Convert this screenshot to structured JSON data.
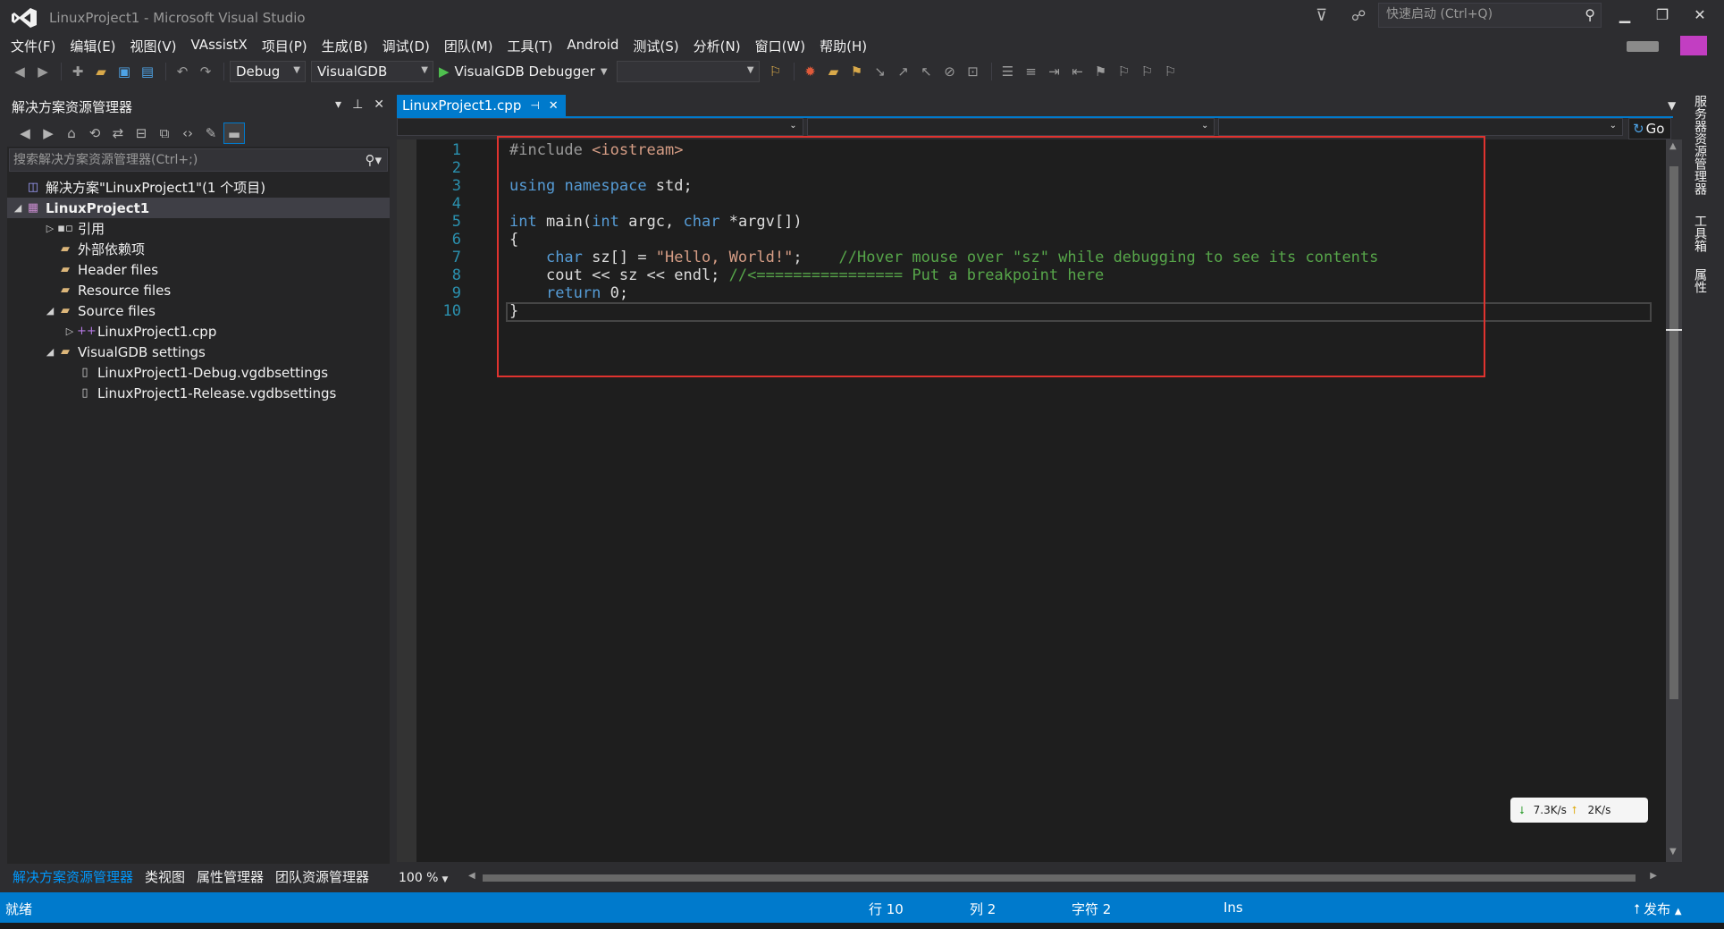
{
  "window": {
    "title": "LinuxProject1 - Microsoft Visual Studio",
    "quicklaunch_placeholder": "快速启动 (Ctrl+Q)",
    "minimize": "▁",
    "maximize": "❐",
    "close": "✕"
  },
  "menu": [
    "文件(F)",
    "编辑(E)",
    "视图(V)",
    "VAssistX",
    "项目(P)",
    "生成(B)",
    "调试(D)",
    "团队(M)",
    "工具(T)",
    "Android",
    "测试(S)",
    "分析(N)",
    "窗口(W)",
    "帮助(H)"
  ],
  "toolbar": {
    "config": "Debug",
    "platform": "VisualGDB",
    "debugger": "VisualGDB Debugger",
    "target": ""
  },
  "solution_explorer": {
    "title": "解决方案资源管理器",
    "search_placeholder": "搜索解决方案资源管理器(Ctrl+;)",
    "tree": [
      {
        "label": "解决方案\"LinuxProject1\"(1 个项目)",
        "icon": "solution-icon"
      },
      {
        "label": "LinuxProject1",
        "icon": "project-icon"
      },
      {
        "label": "引用",
        "icon": "references-icon"
      },
      {
        "label": "外部依赖项",
        "icon": "folder-icon"
      },
      {
        "label": "Header files",
        "icon": "folder-icon"
      },
      {
        "label": "Resource files",
        "icon": "folder-icon"
      },
      {
        "label": "Source files",
        "icon": "folder-icon"
      },
      {
        "label": "LinuxProject1.cpp",
        "icon": "cpp-file-icon"
      },
      {
        "label": "VisualGDB settings",
        "icon": "folder-icon"
      },
      {
        "label": "LinuxProject1-Debug.vgdbsettings",
        "icon": "file-icon"
      },
      {
        "label": "LinuxProject1-Release.vgdbsettings",
        "icon": "file-icon"
      }
    ],
    "bottom_tabs": [
      "解决方案资源管理器",
      "类视图",
      "属性管理器",
      "团队资源管理器"
    ]
  },
  "editor": {
    "tab_label": "LinuxProject1.cpp",
    "go_label": "Go",
    "zoom": "100 %",
    "line_numbers": [
      "1",
      "2",
      "3",
      "4",
      "5",
      "6",
      "7",
      "8",
      "9",
      "10"
    ],
    "code": {
      "l1_pp": "#include",
      "l1_inc": " <iostream>",
      "l3_kw1": "using",
      "l3_kw2": "namespace",
      "l3_rest": " std;",
      "l5_kw1": "int",
      "l5_mid1": " main(",
      "l5_kw2": "int",
      "l5_mid2": " argc, ",
      "l5_kw3": "char",
      "l5_rest": " *argv[])",
      "l6": "{",
      "l7_kw": "char",
      "l7_mid": " sz[] = ",
      "l7_str": "\"Hello, World!\"",
      "l7_semi": ";",
      "l7_cm": "//Hover mouse over \"sz\" while debugging to see its contents",
      "l8_code": "cout << sz << endl; ",
      "l8_cm": "//<================ Put a breakpoint here",
      "l9_kw": "return",
      "l9_rest": " 0;",
      "l10": "}"
    }
  },
  "right_panel_tabs": [
    "服务器资源管理器",
    "工具箱",
    "属性"
  ],
  "net_speed": {
    "down": "7.3K/s",
    "up": "2K/s"
  },
  "status": {
    "ready": "就绪",
    "line": "行 10",
    "col": "列 2",
    "char": "字符 2",
    "mode": "Ins",
    "publish": "发布"
  },
  "colors": {
    "accent": "#007acc",
    "highlight_box": "#e0332f",
    "keyword": "#569cd6",
    "string": "#d69d85",
    "comment": "#57a64a",
    "line_number": "#2b91af"
  }
}
